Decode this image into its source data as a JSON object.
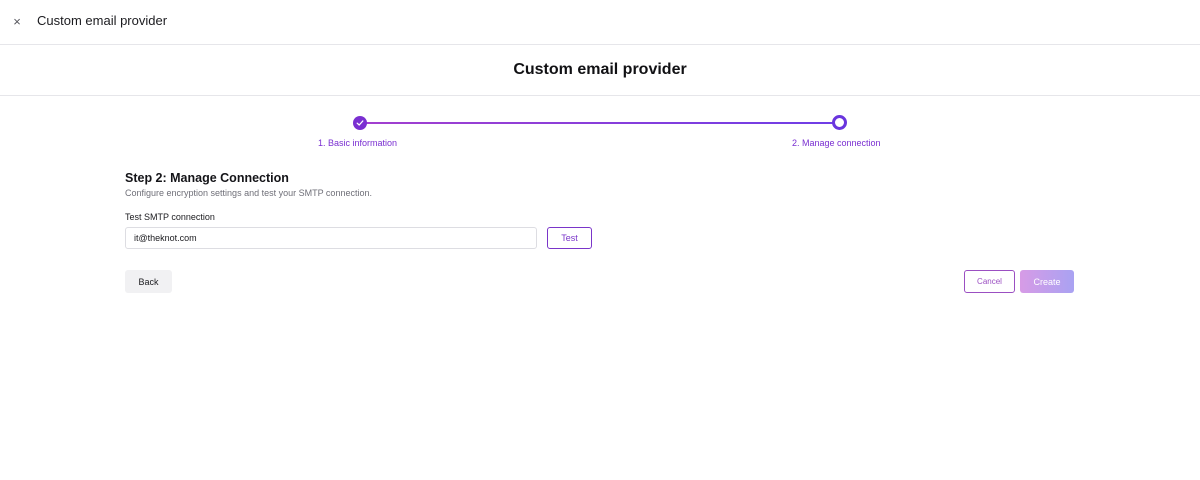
{
  "window": {
    "title": "Custom email provider",
    "close_icon": "×"
  },
  "page": {
    "title": "Custom email provider"
  },
  "stepper": {
    "steps": [
      {
        "label": "1. Basic information",
        "state": "completed",
        "icon": "check-icon"
      },
      {
        "label": "2. Manage connection",
        "state": "current"
      }
    ],
    "colors": {
      "completed": "#7a2fd1",
      "current": "#6a35de",
      "line_start": "#a23fcf",
      "line_end": "#6f3ee6"
    }
  },
  "section": {
    "heading": "Step 2: Manage Connection",
    "description": "Configure encryption settings and test your SMTP connection."
  },
  "smtp_test": {
    "label": "Test SMTP connection",
    "value": "it@theknot.com",
    "button": "Test"
  },
  "actions": {
    "back": "Back",
    "cancel": "Cancel",
    "create": "Create"
  }
}
